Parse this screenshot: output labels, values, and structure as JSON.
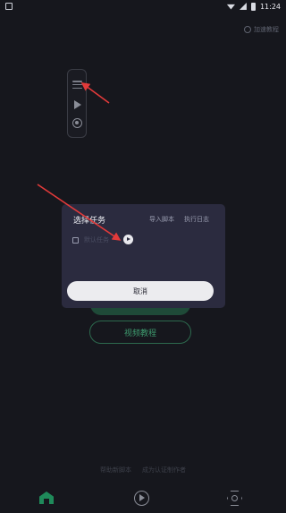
{
  "status_bar": {
    "time": "11:24",
    "icons": [
      "wifi-icon",
      "signal-icon",
      "battery-icon"
    ]
  },
  "header": {
    "help_label": "加速教程"
  },
  "floating_bar": {
    "icons": [
      "menu-icon",
      "play-icon",
      "record-icon"
    ]
  },
  "background": {
    "video_button_label": "视频教程"
  },
  "footer": {
    "links": [
      "帮助新脚本",
      "成为认证制作者"
    ]
  },
  "bottom_nav": {
    "items": [
      {
        "icon": "home-icon",
        "active": true
      },
      {
        "icon": "script-icon",
        "active": false
      },
      {
        "icon": "settings-icon",
        "active": false
      }
    ]
  },
  "dialog": {
    "title": "选择任务",
    "import_label": "导入脚本",
    "log_label": "执行日志",
    "task_name": "默认任务",
    "cancel_label": "取消"
  },
  "colors": {
    "background": "#16171d",
    "dialog": "#2b2b3f",
    "accent": "#1f8a5a",
    "annotation_arrow": "#e23a3a"
  }
}
